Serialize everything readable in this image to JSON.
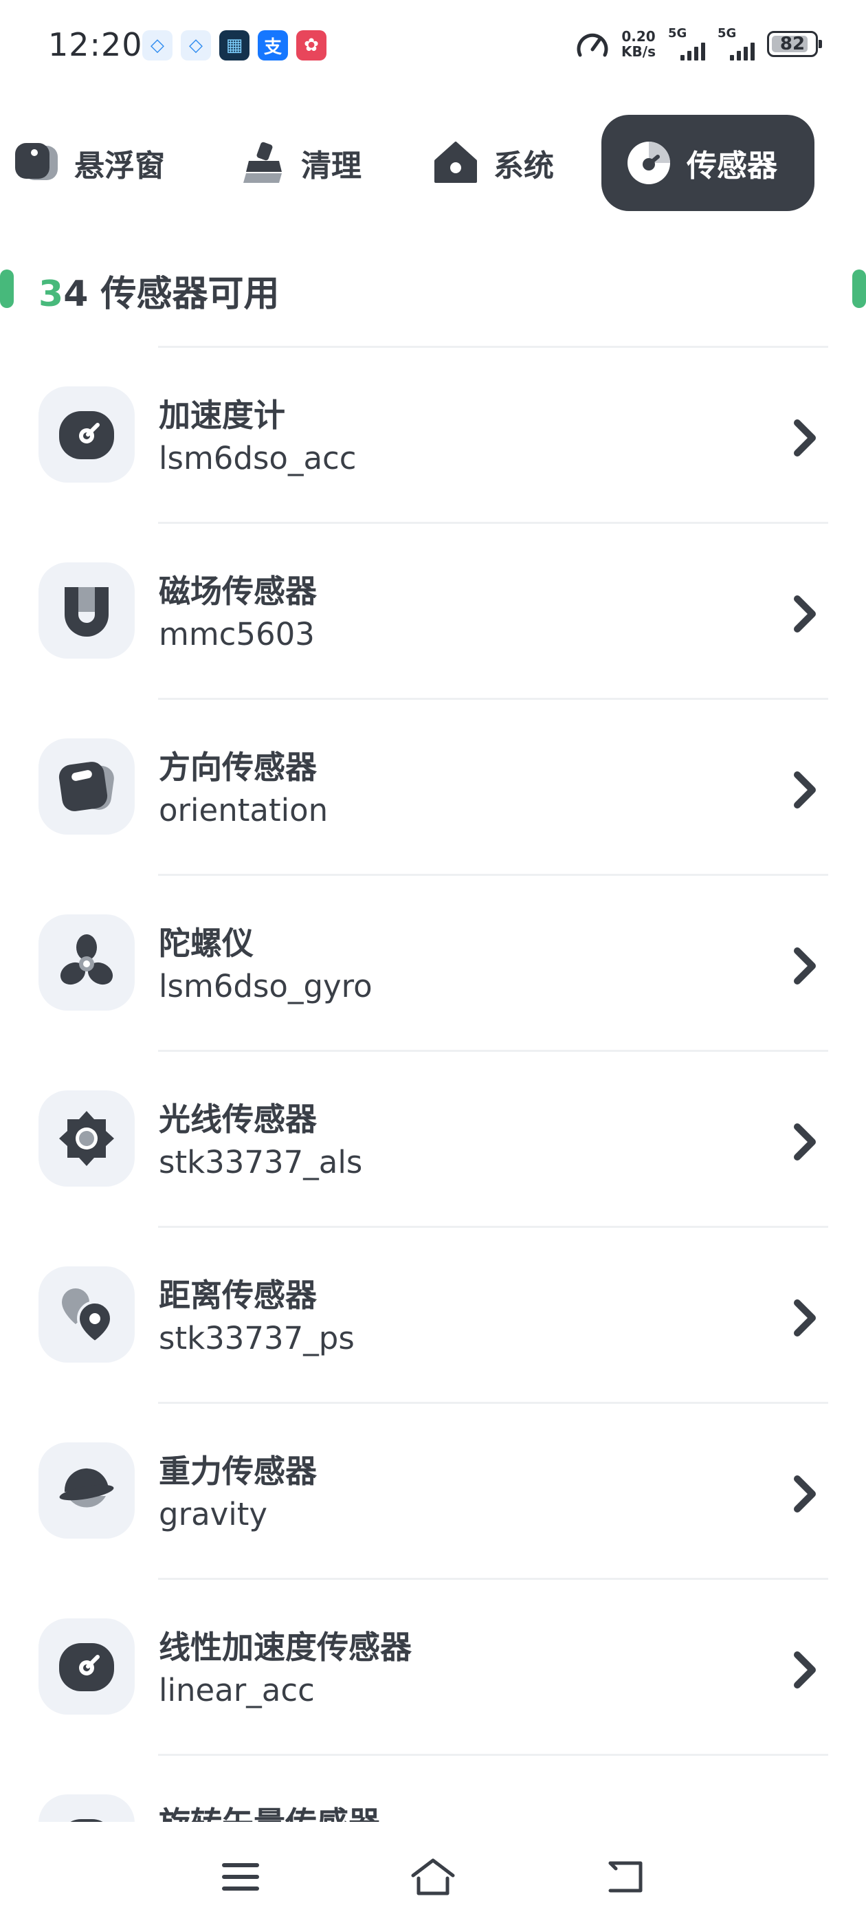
{
  "status_bar": {
    "time": "12:20",
    "net_speed_value": "0.20",
    "net_speed_unit": "KB/s",
    "sim1": "5G",
    "sim2": "5G",
    "battery": "82",
    "notif_icons": [
      {
        "name": "gaopay-icon",
        "color": "#2f8cf0",
        "glyph": "◇"
      },
      {
        "name": "gaopay-icon-2",
        "color": "#2f8cf0",
        "glyph": "◇"
      },
      {
        "name": "calculator-app-icon",
        "color": "#14324d",
        "glyph": "▦"
      },
      {
        "name": "alipay-icon",
        "color": "#1677ff",
        "glyph": "支"
      },
      {
        "name": "game-app-icon",
        "color": "#e8465b",
        "glyph": "✿"
      }
    ]
  },
  "tabs": [
    {
      "label": "悬浮窗",
      "icon": "floating-window-icon",
      "active": false
    },
    {
      "label": "清理",
      "icon": "broom-icon",
      "active": false
    },
    {
      "label": "系统",
      "icon": "house-icon",
      "active": false
    },
    {
      "label": "传感器",
      "icon": "sensor-icon",
      "active": true
    }
  ],
  "header": {
    "count_first_digit": "3",
    "count_rest": "4 传感器可用",
    "accent_color": "#47b97b"
  },
  "sensors": [
    {
      "title": "加速度计",
      "subtitle": "lsm6dso_acc",
      "icon": "gauge-icon"
    },
    {
      "title": "磁场传感器",
      "subtitle": "mmc5603",
      "icon": "magnet-icon"
    },
    {
      "title": "方向传感器",
      "subtitle": "orientation",
      "icon": "orientation-icon"
    },
    {
      "title": "陀螺仪",
      "subtitle": "lsm6dso_gyro",
      "icon": "fan-icon"
    },
    {
      "title": "光线传感器",
      "subtitle": "stk33737_als",
      "icon": "brightness-icon"
    },
    {
      "title": "距离传感器",
      "subtitle": "stk33737_ps",
      "icon": "location-pins-icon"
    },
    {
      "title": "重力传感器",
      "subtitle": "gravity",
      "icon": "planet-icon"
    },
    {
      "title": "线性加速度传感器",
      "subtitle": "linear_acc",
      "icon": "gauge-icon"
    },
    {
      "title": "旋转矢量传感器",
      "subtitle": "",
      "icon": "gauge-icon"
    }
  ]
}
